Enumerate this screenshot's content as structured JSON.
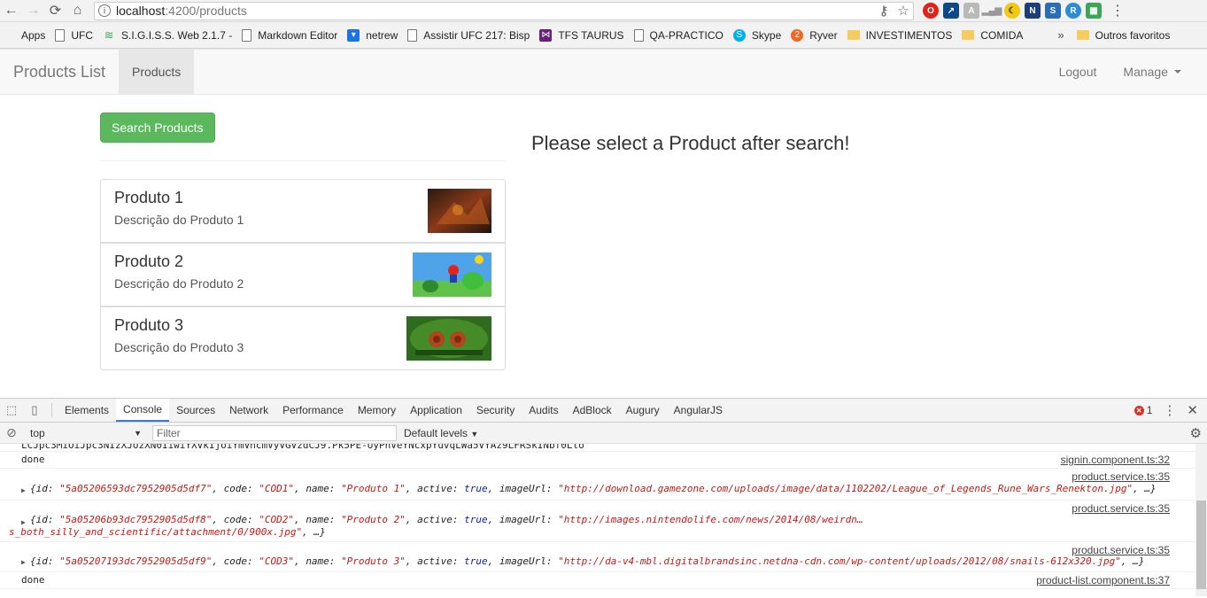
{
  "browser": {
    "url_host": "localhost",
    "url_path": ":4200/products",
    "bookmarks": [
      {
        "label": "Apps",
        "icon": "apps-grid-icon"
      },
      {
        "label": "UFC",
        "icon": "page-icon"
      },
      {
        "label": "S.I.G.I.S.S. Web 2.1.7 -",
        "icon": "wifi-icon"
      },
      {
        "label": "Markdown Editor",
        "icon": "page-icon"
      },
      {
        "label": "netrew",
        "icon": "shield-icon"
      },
      {
        "label": "Assistir UFC 217: Bisp",
        "icon": "page-icon"
      },
      {
        "label": "TFS TAURUS",
        "icon": "visualstudio-icon"
      },
      {
        "label": "QA-PRACTICO",
        "icon": "page-icon"
      },
      {
        "label": "Skype",
        "icon": "skype-icon"
      },
      {
        "label": "Ryver",
        "icon": "ryver-icon"
      },
      {
        "label": "INVESTIMENTOS",
        "icon": "folder-icon"
      },
      {
        "label": "COMIDA",
        "icon": "folder-icon"
      }
    ],
    "more": "»",
    "other_bookmarks": "Outros favoritos"
  },
  "navbar": {
    "brand": "Products List",
    "products_link": "Products",
    "logout": "Logout",
    "manage": "Manage"
  },
  "search_button": "Search Products",
  "placeholder_message": "Please select a Product after search!",
  "products": [
    {
      "name": "Produto 1",
      "description": "Descrição do Produto 1"
    },
    {
      "name": "Produto 2",
      "description": "Descrição do Produto 2"
    },
    {
      "name": "Produto 3",
      "description": "Descrição do Produto 3"
    }
  ],
  "devtools": {
    "tabs": [
      "Elements",
      "Console",
      "Sources",
      "Network",
      "Performance",
      "Memory",
      "Application",
      "Security",
      "Audits",
      "AdBlock",
      "Augury",
      "AngularJS"
    ],
    "active_tab": "Console",
    "error_count": "1",
    "context": "top",
    "filter_placeholder": "Filter",
    "levels": "Default levels",
    "console": {
      "truncated_line": "LCJpc3MiOiJpc3NIzXJUzXN0IiwiYXVkIjoiYmVhcmVyVGVzdCJ9.Pk5PE-UyPhVeYNcxpYuvqLWa5VYAz9LFRSkINbf0Lto",
      "done1": "done",
      "done1_src": "signin.component.ts:32",
      "obj_src": "product.service.ts:35",
      "obj1": {
        "id": "\"5a05206593dc7952905d5df7\"",
        "code": "\"COD1\"",
        "name": "\"Produto 1\"",
        "active": "true",
        "imageUrl": "\"http://download.gamezone.com/uploads/image/data/1102202/League_of_Legends_Rune_Wars_Renekton.jpg\"",
        "more": ", …}"
      },
      "obj2": {
        "id": "\"5a05206b93dc7952905d5df8\"",
        "code": "\"COD2\"",
        "name": "\"Produto 2\"",
        "active": "true",
        "imageUrl": "\"http://images.nintendolife.com/news/2014/08/weirdn…",
        "imageUrl2": "s_both_silly_and_scientific/attachment/0/900x.jpg\"",
        "more": ", …}"
      },
      "obj3": {
        "id": "\"5a05207193dc7952905d5df9\"",
        "code": "\"COD3\"",
        "name": "\"Produto 3\"",
        "active": "true",
        "imageUrl": "\"http://da-v4-mbl.digitalbrandsinc.netdna-cdn.com/wp-content/uploads/2012/08/snails-612x320.jpg\"",
        "more": ", …}"
      },
      "done2": "done",
      "done2_src": "product-list.component.ts:37"
    }
  }
}
